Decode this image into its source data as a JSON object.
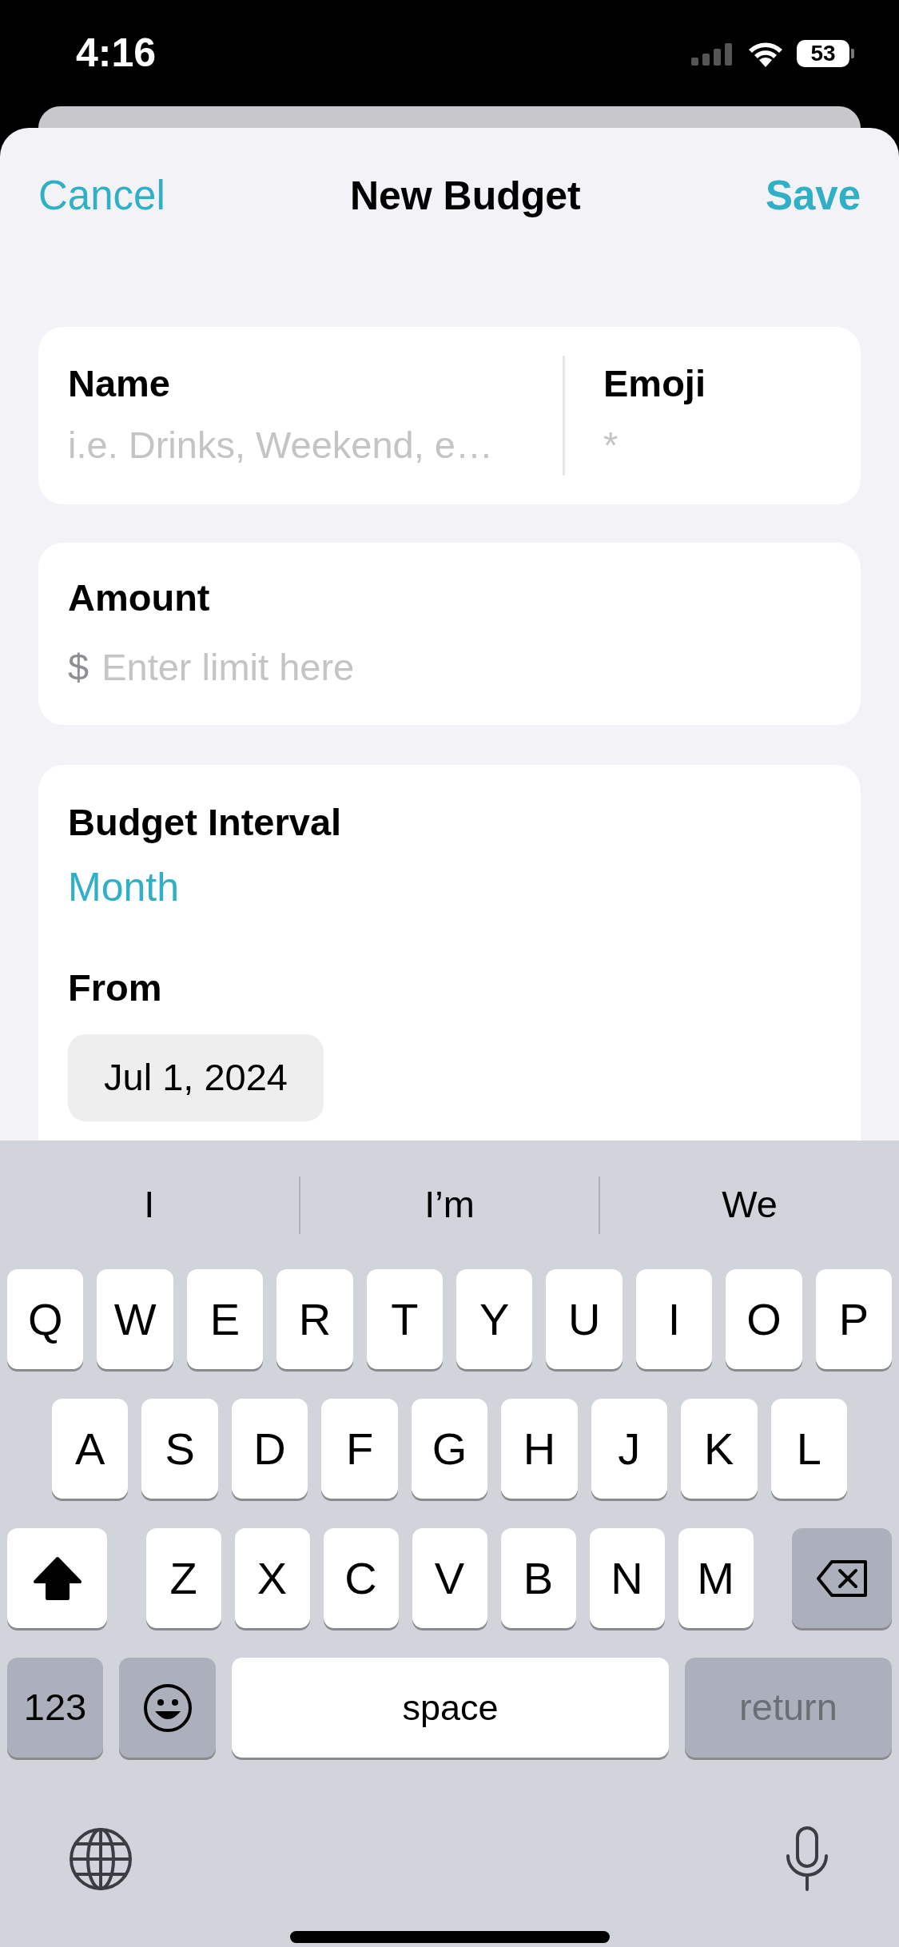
{
  "status_bar": {
    "time": "4:16",
    "battery": "53"
  },
  "nav": {
    "cancel": "Cancel",
    "title": "New Budget",
    "save": "Save"
  },
  "name_field": {
    "label": "Name",
    "placeholder": "i.e. Drinks, Weekend, e…"
  },
  "emoji_field": {
    "label": "Emoji",
    "placeholder": "*"
  },
  "amount_field": {
    "label": "Amount",
    "currency": "$",
    "placeholder": "Enter limit here"
  },
  "interval": {
    "label": "Budget Interval",
    "value": "Month"
  },
  "from": {
    "label": "From",
    "value": "Jul 1, 2024"
  },
  "keyboard": {
    "suggestions": [
      "I",
      "I’m",
      "We"
    ],
    "letter_rows": [
      [
        {
          "kind": "letter",
          "label": "Q"
        },
        {
          "kind": "letter",
          "label": "W"
        },
        {
          "kind": "letter",
          "label": "E"
        },
        {
          "kind": "letter",
          "label": "R"
        },
        {
          "kind": "letter",
          "label": "T"
        },
        {
          "kind": "letter",
          "label": "Y"
        },
        {
          "kind": "letter",
          "label": "U"
        },
        {
          "kind": "letter",
          "label": "I"
        },
        {
          "kind": "letter",
          "label": "O"
        },
        {
          "kind": "letter",
          "label": "P"
        }
      ],
      [
        {
          "kind": "letter",
          "label": "A"
        },
        {
          "kind": "letter",
          "label": "S"
        },
        {
          "kind": "letter",
          "label": "D"
        },
        {
          "kind": "letter",
          "label": "F"
        },
        {
          "kind": "letter",
          "label": "G"
        },
        {
          "kind": "letter",
          "label": "H"
        },
        {
          "kind": "letter",
          "label": "J"
        },
        {
          "kind": "letter",
          "label": "K"
        },
        {
          "kind": "letter",
          "label": "L"
        }
      ],
      [
        {
          "kind": "shift",
          "on": true
        },
        {
          "kind": "letter",
          "label": "Z"
        },
        {
          "kind": "letter",
          "label": "X"
        },
        {
          "kind": "letter",
          "label": "C"
        },
        {
          "kind": "letter",
          "label": "V"
        },
        {
          "kind": "letter",
          "label": "B"
        },
        {
          "kind": "letter",
          "label": "N"
        },
        {
          "kind": "letter",
          "label": "M"
        },
        {
          "kind": "delete"
        }
      ]
    ],
    "bottom_row": [
      {
        "kind": "mode",
        "label": "123"
      },
      {
        "kind": "emoji"
      },
      {
        "kind": "space",
        "label": "space"
      },
      {
        "kind": "return",
        "label": "return",
        "disabled": true
      }
    ]
  }
}
